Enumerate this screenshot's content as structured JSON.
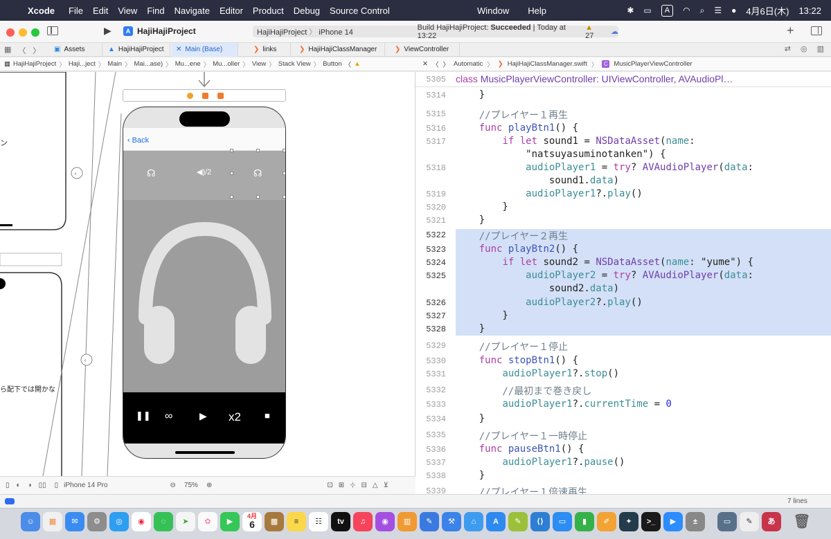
{
  "menubar": {
    "app": "Xcode",
    "items": [
      "File",
      "Edit",
      "View",
      "Find",
      "Navigate",
      "Editor",
      "Product",
      "Debug",
      "Source Control"
    ],
    "center_items": [
      "Window",
      "Help"
    ],
    "input_mode": "A",
    "date": "4月6日(木)",
    "time": "13:22"
  },
  "toolbar": {
    "project": "HajiHajiProject",
    "scheme": "HajiHajiProject",
    "device": "iPhone 14",
    "build_prefix": "Build HajiHajiProject:",
    "build_result": "Succeeded",
    "build_time": "| Today at 13:22",
    "warnings": "27"
  },
  "tabs": [
    {
      "label": "Assets",
      "icon": "asset-catalog-icon"
    },
    {
      "label": "HajiHajiProject",
      "icon": "app-icon"
    },
    {
      "label": "Main (Base)",
      "icon": "storyboard-icon"
    },
    {
      "label": "links",
      "icon": "swift-file-icon"
    },
    {
      "label": "HajiHajiClassManager",
      "icon": "swift-file-icon"
    },
    {
      "label": "ViewController",
      "icon": "swift-file-icon"
    }
  ],
  "left_breadcrumb": [
    "HajiHajiProject",
    "Haji...ject",
    "Main",
    "Mai...ase)",
    "Mu...ene",
    "Mu...oller",
    "View",
    "Stack View",
    "Button"
  ],
  "right_breadcrumb": [
    "Automatic",
    "HajiHajiClassManager.swift",
    "MusicPlayerViewController"
  ],
  "canvas": {
    "back_label": "Back",
    "speaker_label": "◀)/2",
    "speed_label": "x2",
    "left_text_1": "ン",
    "left_text_2": "ら配下では開かな",
    "device_name": "iPhone 14 Pro",
    "zoom": "75%"
  },
  "code": {
    "sticky_line": {
      "num": "5305",
      "text": "class MusicPlayerViewController: UIViewController, AVAudioPl…"
    },
    "lines": [
      {
        "num": "5314",
        "text": "    }"
      },
      {
        "num": "5315",
        "text": "    //プレイヤー１再生"
      },
      {
        "num": "5316",
        "text": "    func playBtn1() {"
      },
      {
        "num": "5317",
        "text": "        if let sound1 = NSDataAsset(name:"
      },
      {
        "num": "",
        "text": "            \"natsuyasuminotanken\") {"
      },
      {
        "num": "5318",
        "text": "            audioPlayer1 = try? AVAudioPlayer(data:"
      },
      {
        "num": "",
        "text": "                sound1.data)"
      },
      {
        "num": "5319",
        "text": "            audioPlayer1?.play()"
      },
      {
        "num": "5320",
        "text": "        }"
      },
      {
        "num": "5321",
        "text": "    }"
      },
      {
        "num": "5322",
        "text": "    //プレイヤー２再生"
      },
      {
        "num": "5323",
        "text": "    func playBtn2() {"
      },
      {
        "num": "5324",
        "text": "        if let sound2 = NSDataAsset(name: \"yume\") {"
      },
      {
        "num": "5325",
        "text": "            audioPlayer2 = try? AVAudioPlayer(data:"
      },
      {
        "num": "",
        "text": "                sound2.data)"
      },
      {
        "num": "5326",
        "text": "            audioPlayer2?.play()"
      },
      {
        "num": "5327",
        "text": "        }"
      },
      {
        "num": "5328",
        "text": "    }"
      },
      {
        "num": "5329",
        "text": "    //プレイヤー１停止"
      },
      {
        "num": "5330",
        "text": "    func stopBtn1() {"
      },
      {
        "num": "5331",
        "text": "        audioPlayer1?.stop()"
      },
      {
        "num": "5332",
        "text": "        //最初まで巻き戻し"
      },
      {
        "num": "5333",
        "text": "        audioPlayer1?.currentTime = 0"
      },
      {
        "num": "5334",
        "text": "    }"
      },
      {
        "num": "5335",
        "text": "    //プレイヤー１一時停止"
      },
      {
        "num": "5336",
        "text": "    func pauseBtn1() {"
      },
      {
        "num": "5337",
        "text": "        audioPlayer1?.pause()"
      },
      {
        "num": "5338",
        "text": "    }"
      },
      {
        "num": "5339",
        "text": "    //プレイヤー１倍速再生"
      }
    ]
  },
  "status": {
    "lines": "7 lines"
  },
  "dock": {
    "calendar_month": "4月",
    "calendar_day": "6"
  }
}
